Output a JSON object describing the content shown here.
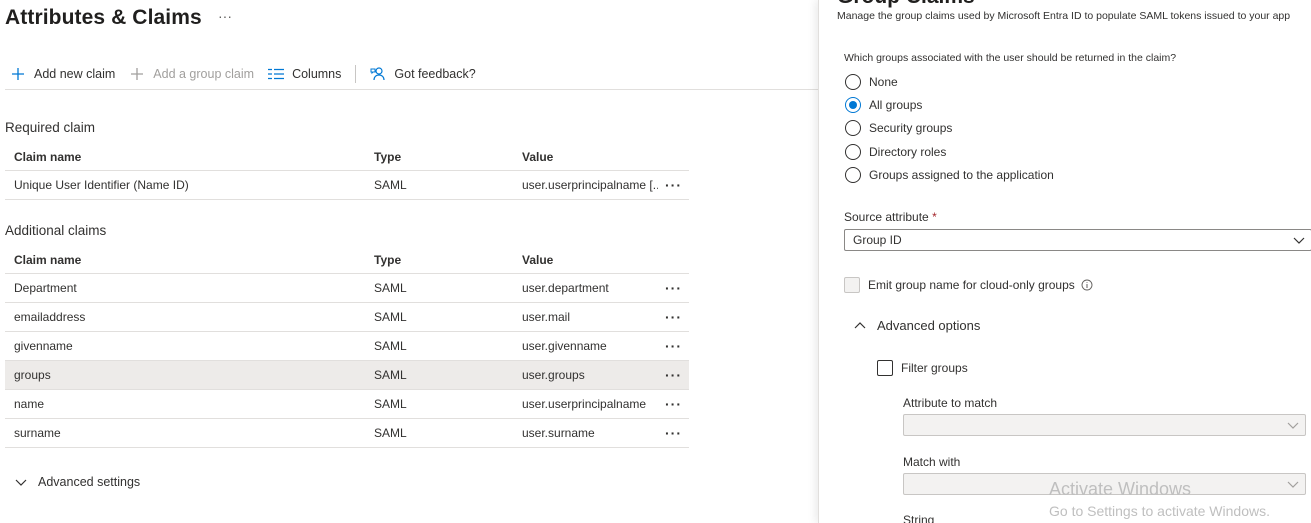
{
  "page": {
    "title": "Attributes & Claims",
    "more_label": "···"
  },
  "toolbar": {
    "add_claim": "Add new claim",
    "add_group_claim": "Add a group claim",
    "columns": "Columns",
    "feedback": "Got feedback?"
  },
  "required": {
    "section_title": "Required claim",
    "headers": {
      "name": "Claim name",
      "type": "Type",
      "value": "Value"
    },
    "rows": [
      {
        "name": "Unique User Identifier (Name ID)",
        "type": "SAML",
        "value": "user.userprincipalname [..."
      }
    ]
  },
  "additional": {
    "section_title": "Additional claims",
    "headers": {
      "name": "Claim name",
      "type": "Type",
      "value": "Value"
    },
    "rows": [
      {
        "name": "Department",
        "type": "SAML",
        "value": "user.department"
      },
      {
        "name": "emailaddress",
        "type": "SAML",
        "value": "user.mail"
      },
      {
        "name": "givenname",
        "type": "SAML",
        "value": "user.givenname"
      },
      {
        "name": "groups",
        "type": "SAML",
        "value": "user.groups"
      },
      {
        "name": "name",
        "type": "SAML",
        "value": "user.userprincipalname"
      },
      {
        "name": "surname",
        "type": "SAML",
        "value": "user.surname"
      }
    ]
  },
  "advanced_settings": {
    "label": "Advanced settings"
  },
  "panel": {
    "title": "Group Claims",
    "description": "Manage the group claims used by Microsoft Entra ID to populate SAML tokens issued to your app",
    "question": "Which groups associated with the user should be returned in the claim?",
    "options": [
      {
        "label": "None",
        "checked": false
      },
      {
        "label": "All groups",
        "checked": true
      },
      {
        "label": "Security groups",
        "checked": false
      },
      {
        "label": "Directory roles",
        "checked": false
      },
      {
        "label": "Groups assigned to the application",
        "checked": false
      }
    ],
    "source_attribute": {
      "label": "Source attribute",
      "required_mark": "*",
      "value": "Group ID"
    },
    "emit_cloud_only": {
      "label": "Emit group name for cloud-only groups",
      "checked": false
    },
    "advanced_options": {
      "label": "Advanced options"
    },
    "filter_groups": {
      "label": "Filter groups",
      "checked": false
    },
    "attribute_to_match": {
      "label": "Attribute to match",
      "value": ""
    },
    "match_with": {
      "label": "Match with",
      "value": ""
    },
    "string": {
      "label": "String"
    }
  },
  "watermark": {
    "line1": "Activate Windows",
    "line2": "Go to Settings to activate Windows."
  },
  "colors": {
    "accent": "#0078d4",
    "required": "#a4262c",
    "selected_row": "#edebe9"
  }
}
